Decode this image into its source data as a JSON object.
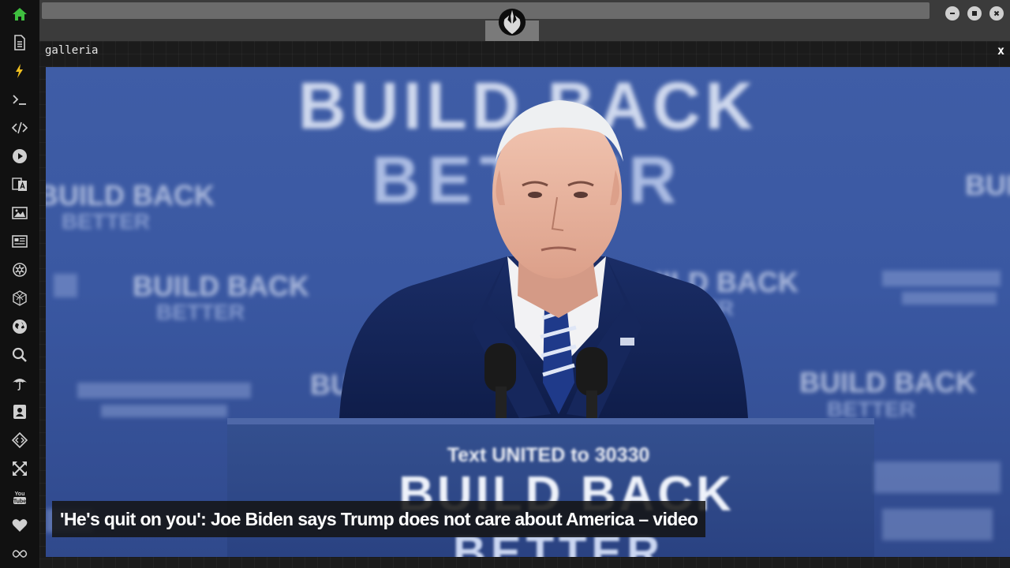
{
  "window": {
    "panel_title": "galleria",
    "close_glyph": "x"
  },
  "rail": {
    "icons": [
      "home-icon",
      "document-icon",
      "lightning-icon",
      "terminal-icon",
      "code-icon",
      "play-icon",
      "translate-icon",
      "image-icon",
      "news-icon",
      "settings-icon",
      "cube-icon",
      "globe-icon",
      "search-icon",
      "umbrella-icon",
      "contacts-icon",
      "diamond-code-icon",
      "expand-icon",
      "youtube-icon",
      "heart-icon",
      "infinity-icon"
    ],
    "active_color": "#3fbf3f",
    "accent_color": "#f0c020"
  },
  "gallery": {
    "caption": "'He's quit on you': Joe Biden says Trump does not care about America – video",
    "image_text": {
      "banner_line1": "BUILD BACK",
      "banner_line2": "BETTER",
      "podium_text": "Text UNITED to 30330",
      "podium_banner": "BUILD BACK",
      "podium_banner2": "BETTER",
      "bg_small1": "BUILD BACK",
      "bg_small2": "BETTER"
    }
  }
}
